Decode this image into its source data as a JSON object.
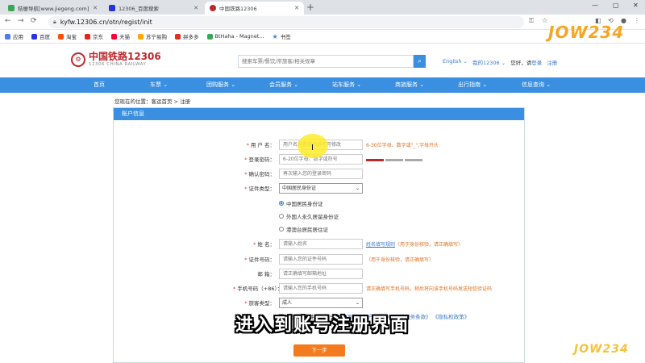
{
  "browser": {
    "tabs": [
      {
        "title": "秸梗导航[www.jiegeng.com]_秸",
        "active": false,
        "color": "#3aa757"
      },
      {
        "title": "12306_百度搜索",
        "active": false,
        "color": "#2932e1"
      },
      {
        "title": "中国铁路12306",
        "active": true,
        "color": "#c0272d"
      }
    ],
    "new_tab": "+",
    "url": "kyfw.12306.cn/otn/regist/init",
    "bookmarks": [
      {
        "label": "应用",
        "color": "#4a7ee0"
      },
      {
        "label": "百度",
        "color": "#2932e1"
      },
      {
        "label": "淘宝",
        "color": "#ff5000"
      },
      {
        "label": "京东",
        "color": "#e1251b"
      },
      {
        "label": "天猫",
        "color": "#ff0036"
      },
      {
        "label": "苏宁易购",
        "color": "#ffaa00"
      },
      {
        "label": "拼多多",
        "color": "#e02e24"
      },
      {
        "label": "BtHaha - Magnet...",
        "color": "#3aa757"
      },
      {
        "label": "书签",
        "color": "#4a7ee0"
      }
    ]
  },
  "header": {
    "logo_cn": "中国铁路12306",
    "logo_en": "12306 CHINA RAILWAY",
    "search_placeholder": "搜索车票/餐饮/常旅客/相关规章",
    "english": "English ⌄",
    "my12306": "我的12306 ⌄",
    "greeting": "您好，请",
    "login": "登录",
    "register": "注册"
  },
  "nav": [
    {
      "label": "首页"
    },
    {
      "label": "车票 ⌄"
    },
    {
      "label": "团购服务 ⌄"
    },
    {
      "label": "会员服务 ⌄"
    },
    {
      "label": "站车服务 ⌄"
    },
    {
      "label": "商旅服务 ⌄"
    },
    {
      "label": "出行指南 ⌄"
    },
    {
      "label": "信息查询 ⌄"
    }
  ],
  "breadcrumb": "您现在的位置：客运首页 > 注册",
  "panel_title": "账户信息",
  "form": {
    "username_label": "用 户 名：",
    "username_placeholder": "用户名设置成功后不可修改",
    "username_hint": "6-30位字母、数字或\"_\",字母开头",
    "password_label": "登录密码：",
    "password_placeholder": "6-20位字母、数字或符号",
    "confirm_label": "确认密码：",
    "confirm_placeholder": "再次输入您的登录密码",
    "idtype_label": "证件类型：",
    "idtype_value": "中国居民身份证",
    "id_options": [
      "中国居民身份证",
      "外国人永久居留身份证",
      "港澳台居民居住证"
    ],
    "name_label": "姓 名：",
    "name_placeholder": "请输入姓名",
    "name_hint_link": "姓名填写规则",
    "name_hint": "（用于身份核验，请正确填写）",
    "idno_label": "证件号码：",
    "idno_placeholder": "请输入您的证件号码",
    "idno_hint": "（用于身份核验，请正确填写）",
    "email_label": "邮 箱：",
    "email_placeholder": "请正确填写邮箱地址",
    "phone_label": "手机号码（+86）：",
    "phone_placeholder": "请输入您的手机号码",
    "phone_hint": "请正确填写手机号码，稍后将向该手机号码发送短信验证码",
    "passenger_label": "旅客类型：",
    "passenger_value": "成人",
    "agree_prefix": "我已阅读并同意遵守",
    "agree_link1": "《中国铁路客户服务中心网站服务条款》",
    "agree_link2": "《隐私权政策》",
    "next": "下一步"
  },
  "subtitle": "进入到账号注册界面",
  "watermark": "JOW234"
}
